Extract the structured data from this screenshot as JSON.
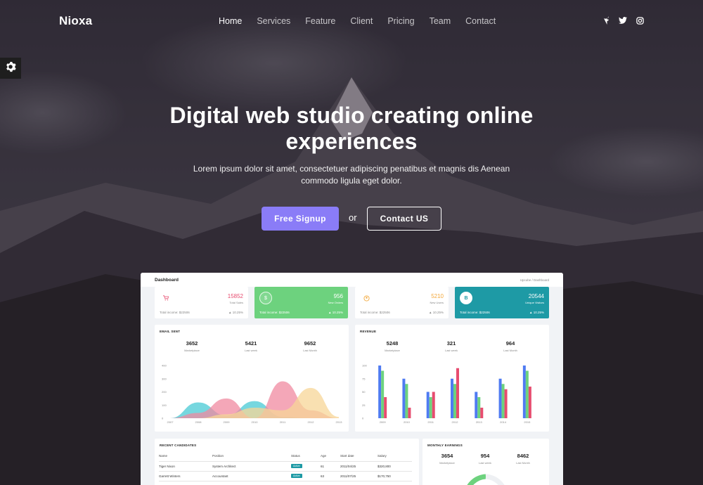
{
  "brand": "Nioxa",
  "nav": {
    "items": [
      {
        "label": "Home",
        "active": true
      },
      {
        "label": "Services",
        "active": false
      },
      {
        "label": "Feature",
        "active": false
      },
      {
        "label": "Client",
        "active": false
      },
      {
        "label": "Pricing",
        "active": false
      },
      {
        "label": "Team",
        "active": false
      },
      {
        "label": "Contact",
        "active": false
      }
    ],
    "social": [
      "facebook-icon",
      "twitter-icon",
      "instagram-icon"
    ]
  },
  "settings_icon": "gear-icon",
  "hero": {
    "title_line1": "Digital web studio creating online",
    "title_line2": "experiences",
    "subtitle_line1": "Lorem ipsum dolor sit amet, consectetuer adipiscing penatibus et magnis dis Aenean",
    "subtitle_line2": "commodo ligula eget dolor.",
    "signup_label": "Free Signup",
    "or_label": "or",
    "contact_label": "Contact US"
  },
  "colors": {
    "accent": "#8a7cf7",
    "green": "#6dd27e",
    "teal": "#1e9aa5",
    "red": "#e74c6f",
    "orange": "#f3a83b"
  },
  "dashboard": {
    "title": "Dashboard",
    "breadcrumb": "Upcube  /  Dashboard",
    "stats": [
      {
        "value": "15852",
        "label": "Total Sales",
        "income": "Total income: $22506",
        "pct": "▲ 10.25%",
        "icon": "cart-icon"
      },
      {
        "value": "956",
        "label": "New Orders",
        "income": "Total income: $22506",
        "pct": "▲ 10.25%",
        "icon": "dollar-icon"
      },
      {
        "value": "5210",
        "label": "New Users",
        "income": "Total income: $22506",
        "pct": "▲ 10.25%",
        "icon": "user-icon"
      },
      {
        "value": "20544",
        "label": "Unique Visitors",
        "income": "Total income: $22506",
        "pct": "▲ 10.25%",
        "icon": "bitcoin-icon"
      }
    ],
    "email_sent": {
      "title": "EMAIL SENT",
      "kpis": [
        {
          "value": "3652",
          "label": "Marketplace"
        },
        {
          "value": "5421",
          "label": "Last week"
        },
        {
          "value": "9652",
          "label": "Last Month"
        }
      ]
    },
    "revenue": {
      "title": "REVENUE",
      "kpis": [
        {
          "value": "5248",
          "label": "Marketplace"
        },
        {
          "value": "321",
          "label": "Last week"
        },
        {
          "value": "964",
          "label": "Last Month"
        }
      ]
    },
    "candidates": {
      "title": "RECENT CANDIDATES",
      "columns": [
        "Name",
        "Position",
        "Status",
        "Age",
        "Start date",
        "Salary"
      ],
      "rows": [
        [
          "Tiger Nixon",
          "System Architect",
          "Active",
          "61",
          "2011/04/25",
          "$320,800"
        ],
        [
          "Garrett Winters",
          "Accountant",
          "Active",
          "63",
          "2011/07/25",
          "$170,750"
        ]
      ]
    },
    "monthly": {
      "title": "MONTHLY EARNINGS",
      "kpis": [
        {
          "value": "3654",
          "label": "Marketplace"
        },
        {
          "value": "954",
          "label": "Last week"
        },
        {
          "value": "8462",
          "label": "Last Month"
        }
      ]
    }
  },
  "chart_data": [
    {
      "type": "area",
      "title": "",
      "x": [
        "2007",
        "2008",
        "2009",
        "2010",
        "2011",
        "2012",
        "2013"
      ],
      "ylim": [
        0,
        400
      ],
      "yticks": [
        "400",
        "300",
        "200",
        "100",
        "0"
      ],
      "series": [
        {
          "values": [
            0,
            120,
            20,
            130,
            10,
            0,
            0
          ],
          "color": "#48c9d4"
        },
        {
          "values": [
            0,
            40,
            150,
            0,
            280,
            60,
            0
          ],
          "color": "#f08aa0"
        },
        {
          "values": [
            0,
            0,
            30,
            80,
            60,
            230,
            10
          ],
          "color": "#f7d597"
        }
      ]
    },
    {
      "type": "bar",
      "title": "",
      "categories": [
        "2009",
        "2010",
        "2011",
        "2012",
        "2013",
        "2014",
        "2015"
      ],
      "ylim": [
        0,
        100
      ],
      "yticks": [
        "100",
        "75",
        "50",
        "25",
        "0"
      ],
      "series": [
        {
          "values": [
            100,
            75,
            50,
            75,
            50,
            75,
            100
          ],
          "color": "#4f7bf2"
        },
        {
          "values": [
            90,
            65,
            40,
            65,
            40,
            65,
            90
          ],
          "color": "#6dd27e"
        },
        {
          "values": [
            40,
            20,
            50,
            95,
            20,
            55,
            60
          ],
          "color": "#e74c6f"
        }
      ]
    }
  ]
}
